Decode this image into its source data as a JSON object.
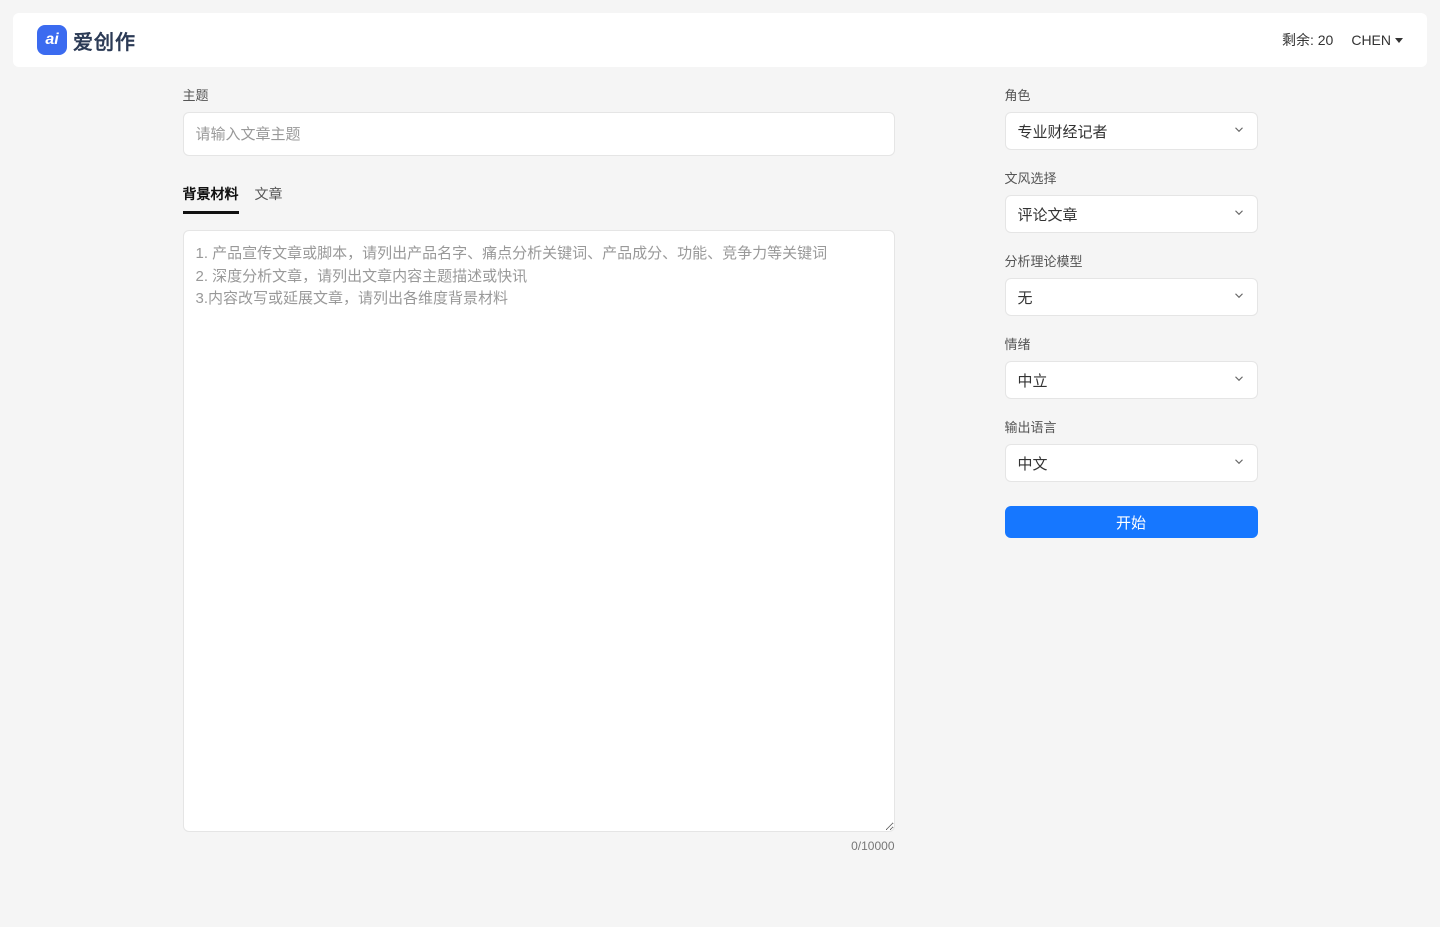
{
  "header": {
    "logo_icon_text": "ai",
    "logo_main": "爱创作",
    "remaining_label": "剩余:",
    "remaining_value": "20",
    "username": "CHEN"
  },
  "main": {
    "topic_label": "主题",
    "topic_placeholder": "请输入文章主题",
    "topic_value": "",
    "tabs": [
      {
        "label": "背景材料",
        "active": true
      },
      {
        "label": "文章",
        "active": false
      }
    ],
    "background_placeholder": "1. 产品宣传文章或脚本，请列出产品名字、痛点分析关键词、产品成分、功能、竞争力等关键词\n2. 深度分析文章，请列出文章内容主题描述或快讯\n3.内容改写或延展文章，请列出各维度背景材料",
    "background_value": "",
    "char_count": "0/10000"
  },
  "side": {
    "role": {
      "label": "角色",
      "value": "专业财经记者"
    },
    "style": {
      "label": "文风选择",
      "value": "评论文章"
    },
    "model": {
      "label": "分析理论模型",
      "value": "无"
    },
    "emotion": {
      "label": "情绪",
      "value": "中立"
    },
    "language": {
      "label": "输出语言",
      "value": "中文"
    },
    "start_label": "开始"
  }
}
